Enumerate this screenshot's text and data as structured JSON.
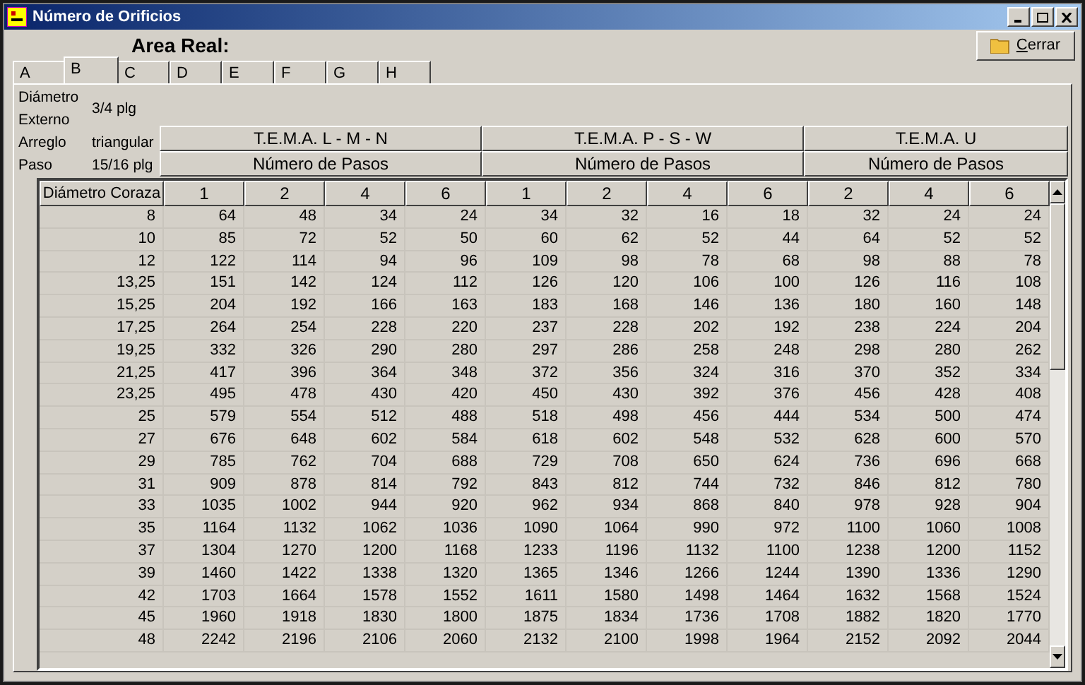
{
  "window": {
    "title": "Número de Orificios"
  },
  "heading": "Area Real:",
  "close_button": {
    "label": "Cerrar"
  },
  "tabs": [
    {
      "label": "A",
      "selected": false
    },
    {
      "label": "B",
      "selected": true
    },
    {
      "label": "C",
      "selected": false
    },
    {
      "label": "D",
      "selected": false
    },
    {
      "label": "E",
      "selected": false
    },
    {
      "label": "F",
      "selected": false
    },
    {
      "label": "G",
      "selected": false
    },
    {
      "label": "H",
      "selected": false
    }
  ],
  "info": [
    {
      "label": "Diámetro Externo",
      "value": "3/4 plg"
    },
    {
      "label": "Arreglo",
      "value": "triangular"
    },
    {
      "label": "Paso",
      "value": "15/16 plg"
    }
  ],
  "groups": [
    {
      "title": "T.E.M.A. L - M - N",
      "subtitle": "Número de Pasos",
      "columns": [
        "1",
        "2",
        "4",
        "6"
      ]
    },
    {
      "title": "T.E.M.A. P - S - W",
      "subtitle": "Número de Pasos",
      "columns": [
        "1",
        "2",
        "4",
        "6"
      ]
    },
    {
      "title": "T.E.M.A. U",
      "subtitle": "Número de Pasos",
      "columns": [
        "2",
        "4",
        "6"
      ]
    }
  ],
  "table": {
    "first_column": "Diámetro Coraza",
    "rows": [
      [
        "8",
        "64",
        "48",
        "34",
        "24",
        "34",
        "32",
        "16",
        "18",
        "32",
        "24",
        "24"
      ],
      [
        "10",
        "85",
        "72",
        "52",
        "50",
        "60",
        "62",
        "52",
        "44",
        "64",
        "52",
        "52"
      ],
      [
        "12",
        "122",
        "114",
        "94",
        "96",
        "109",
        "98",
        "78",
        "68",
        "98",
        "88",
        "78"
      ],
      [
        "13,25",
        "151",
        "142",
        "124",
        "112",
        "126",
        "120",
        "106",
        "100",
        "126",
        "116",
        "108"
      ],
      [
        "15,25",
        "204",
        "192",
        "166",
        "163",
        "183",
        "168",
        "146",
        "136",
        "180",
        "160",
        "148"
      ],
      [
        "17,25",
        "264",
        "254",
        "228",
        "220",
        "237",
        "228",
        "202",
        "192",
        "238",
        "224",
        "204"
      ],
      [
        "19,25",
        "332",
        "326",
        "290",
        "280",
        "297",
        "286",
        "258",
        "248",
        "298",
        "280",
        "262"
      ],
      [
        "21,25",
        "417",
        "396",
        "364",
        "348",
        "372",
        "356",
        "324",
        "316",
        "370",
        "352",
        "334"
      ],
      [
        "23,25",
        "495",
        "478",
        "430",
        "420",
        "450",
        "430",
        "392",
        "376",
        "456",
        "428",
        "408"
      ],
      [
        "25",
        "579",
        "554",
        "512",
        "488",
        "518",
        "498",
        "456",
        "444",
        "534",
        "500",
        "474"
      ],
      [
        "27",
        "676",
        "648",
        "602",
        "584",
        "618",
        "602",
        "548",
        "532",
        "628",
        "600",
        "570"
      ],
      [
        "29",
        "785",
        "762",
        "704",
        "688",
        "729",
        "708",
        "650",
        "624",
        "736",
        "696",
        "668"
      ],
      [
        "31",
        "909",
        "878",
        "814",
        "792",
        "843",
        "812",
        "744",
        "732",
        "846",
        "812",
        "780"
      ],
      [
        "33",
        "1035",
        "1002",
        "944",
        "920",
        "962",
        "934",
        "868",
        "840",
        "978",
        "928",
        "904"
      ],
      [
        "35",
        "1164",
        "1132",
        "1062",
        "1036",
        "1090",
        "1064",
        "990",
        "972",
        "1100",
        "1060",
        "1008"
      ],
      [
        "37",
        "1304",
        "1270",
        "1200",
        "1168",
        "1233",
        "1196",
        "1132",
        "1100",
        "1238",
        "1200",
        "1152"
      ],
      [
        "39",
        "1460",
        "1422",
        "1338",
        "1320",
        "1365",
        "1346",
        "1266",
        "1244",
        "1390",
        "1336",
        "1290"
      ],
      [
        "42",
        "1703",
        "1664",
        "1578",
        "1552",
        "1611",
        "1580",
        "1498",
        "1464",
        "1632",
        "1568",
        "1524"
      ],
      [
        "45",
        "1960",
        "1918",
        "1830",
        "1800",
        "1875",
        "1834",
        "1736",
        "1708",
        "1882",
        "1820",
        "1770"
      ],
      [
        "48",
        "2242",
        "2196",
        "2106",
        "2060",
        "2132",
        "2100",
        "1998",
        "1964",
        "2152",
        "2092",
        "2044"
      ]
    ]
  }
}
